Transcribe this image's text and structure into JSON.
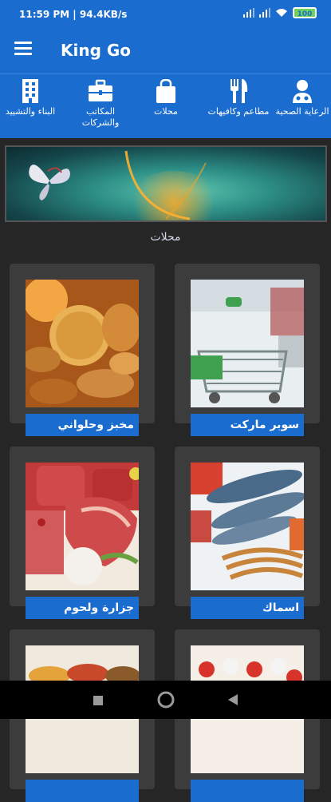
{
  "status": {
    "time": "11:59 PM | 94.4KB/s",
    "battery": "100"
  },
  "appbar": {
    "title": "King Go"
  },
  "categories": [
    {
      "label": "الرعاية الصحية",
      "icon": "doctor-icon"
    },
    {
      "label": "مطاعم وكافيهات",
      "icon": "fork-knife-icon"
    },
    {
      "label": "محلات",
      "icon": "shopping-bag-icon"
    },
    {
      "label": "المكاتب والشركات",
      "icon": "briefcase-icon"
    },
    {
      "label": "البناء والتشييد",
      "icon": "building-icon"
    }
  ],
  "section": {
    "title": "محلات"
  },
  "cards": [
    {
      "label": "سوبر ماركت"
    },
    {
      "label": "مخبز وحلواني"
    },
    {
      "label": "اسماك"
    },
    {
      "label": "جزارة ولحوم"
    },
    {
      "label": ""
    },
    {
      "label": ""
    }
  ],
  "colors": {
    "primary": "#1a6ccf",
    "background": "#262626",
    "card": "#3c3c3c"
  }
}
